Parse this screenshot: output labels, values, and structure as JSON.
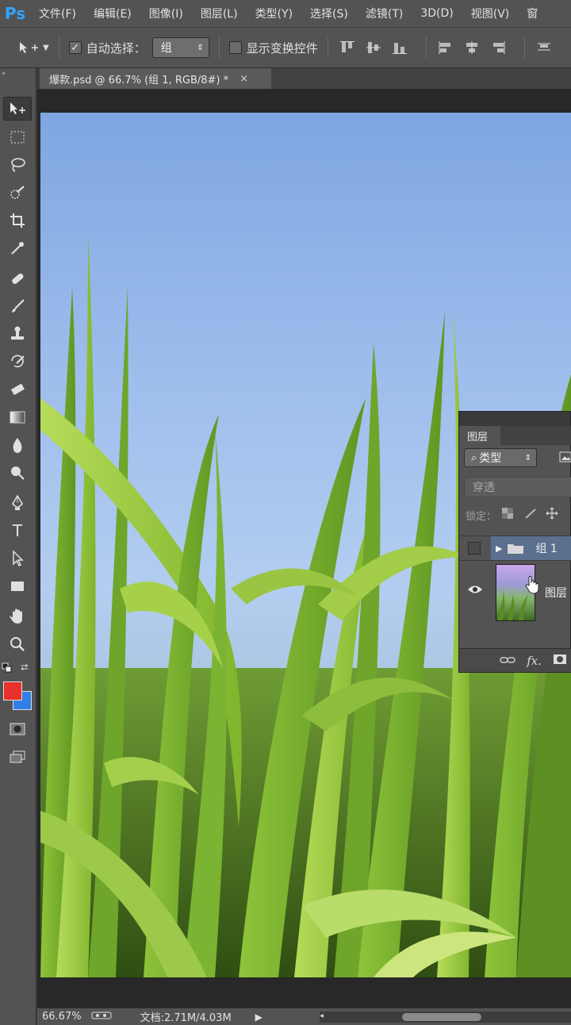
{
  "app": {
    "logo_text": "Ps"
  },
  "menu": {
    "items": [
      "文件(F)",
      "编辑(E)",
      "图像(I)",
      "图层(L)",
      "类型(Y)",
      "选择(S)",
      "滤镜(T)",
      "3D(D)",
      "视图(V)",
      "窗"
    ]
  },
  "options_bar": {
    "auto_select_label": "自动选择：",
    "auto_select_checked": true,
    "auto_select_value": "组",
    "show_transform_label": "显示变换控件",
    "show_transform_checked": false
  },
  "document_tab": {
    "title": "爆款.psd @ 66.7% (组 1, RGB/8#) *",
    "close_glyph": "×"
  },
  "tools": [
    "move-tool",
    "marquee-tool",
    "lasso-tool",
    "quick-select-tool",
    "crop-tool",
    "eyedropper-tool",
    "healing-brush-tool",
    "brush-tool",
    "clone-stamp-tool",
    "history-brush-tool",
    "eraser-tool",
    "gradient-tool",
    "blur-tool",
    "dodge-tool",
    "pen-tool",
    "type-tool",
    "path-select-tool",
    "rectangle-tool",
    "hand-tool",
    "zoom-tool"
  ],
  "colors": {
    "foreground": "#e8302c",
    "background": "#2f7fe6",
    "selection": "#5b6f8e",
    "ps_blue": "#33a3ff"
  },
  "status_bar": {
    "zoom": "66.67%",
    "doc_info": "文档:2.71M/4.03M"
  },
  "layers_panel": {
    "tab_label": "图层",
    "filter_label": "类型",
    "blend_mode": "穿透",
    "lock_label": "锁定：",
    "group_name": "组 1",
    "layer_name": "图层"
  }
}
